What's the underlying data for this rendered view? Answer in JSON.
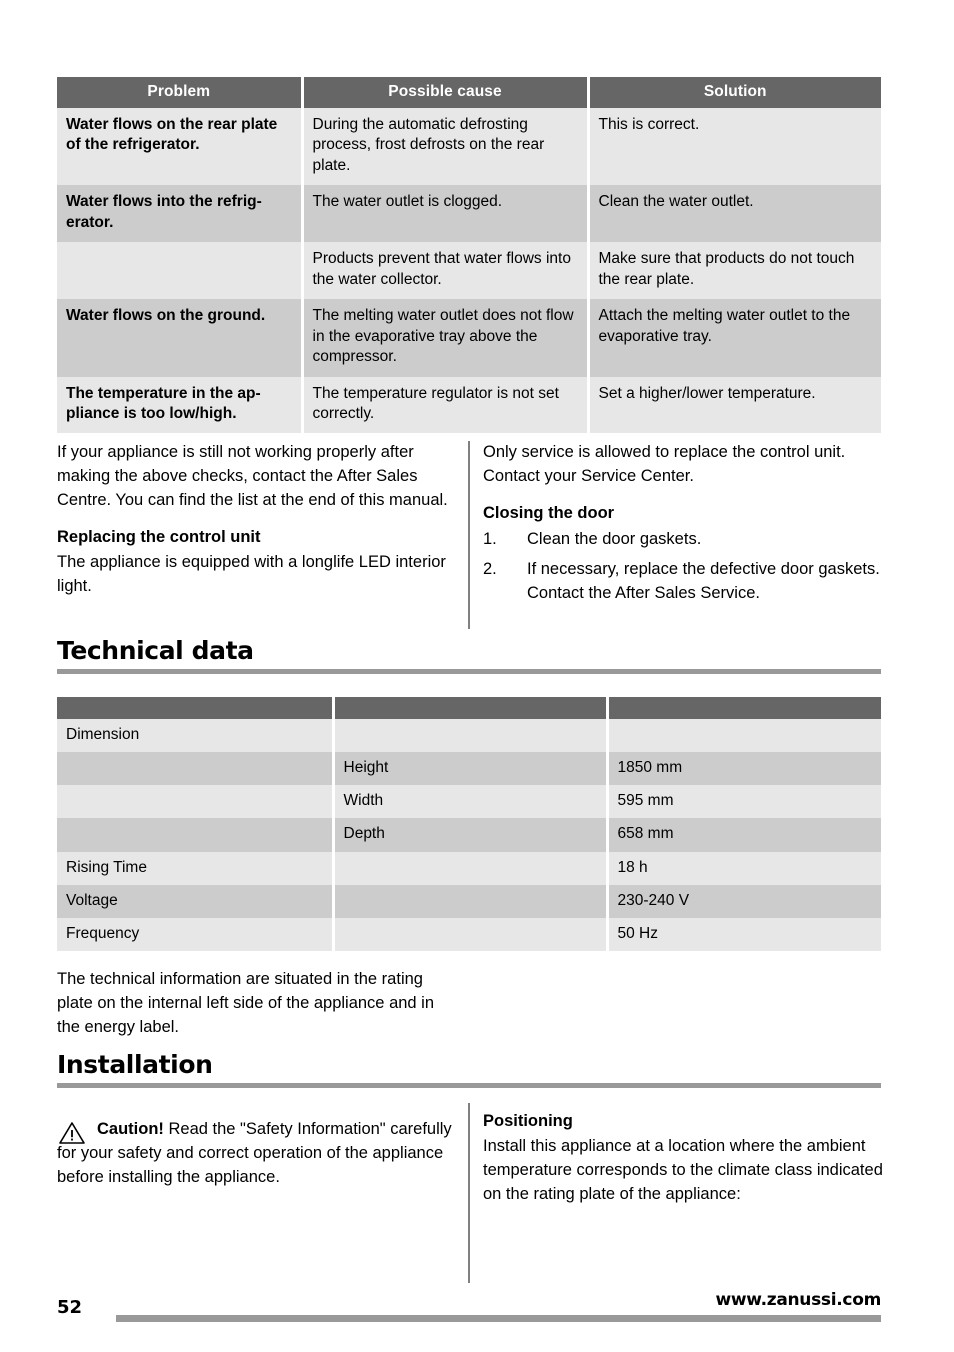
{
  "troubleshooting_table": {
    "headers": [
      "Problem",
      "Possible cause",
      "Solution"
    ],
    "rows": [
      {
        "problem": "Water flows on the rear plate of the refrigerator.",
        "cause": "During the automatic defrosting process, frost defrosts on the rear plate.",
        "solution": "This is correct."
      },
      {
        "problem": "Water flows into the refrig-erator.",
        "cause": "The water outlet is clogged.",
        "solution": "Clean the water outlet."
      },
      {
        "problem": "",
        "cause": "Products prevent that water flows into the water collector.",
        "solution": "Make sure that products do not touch the rear plate."
      },
      {
        "problem": "Water flows on the ground.",
        "cause": "The melting water outlet does not flow in the evaporative tray above the compressor.",
        "solution": "Attach the melting water outlet to the evaporative tray."
      },
      {
        "problem": "The temperature in the ap-pliance is too low/high.",
        "cause": "The temperature regulator is not set correctly.",
        "solution": "Set a higher/lower temperature."
      }
    ]
  },
  "service_columns": {
    "left": {
      "intro": "If your appliance is still not working properly after making the above checks, contact the After Sales Centre. You can find the list at the end of this manual.",
      "heading": "Replacing the control unit",
      "body": "The appliance is equipped with a longlife LED interior light."
    },
    "right": {
      "intro": "Only service is allowed to replace the control unit. Contact your Service Center.",
      "heading": "Closing the door",
      "steps": [
        {
          "num": "1.",
          "text": "Clean the door gaskets."
        },
        {
          "num": "2.",
          "text": "If necessary, replace the defective door gaskets. Contact the After Sales Service."
        }
      ]
    }
  },
  "technical_data": {
    "heading": "Technical data",
    "headers": [
      "",
      "",
      ""
    ],
    "rows": [
      {
        "label": "Dimension",
        "sub": "",
        "value": ""
      },
      {
        "label": "",
        "sub": "Height",
        "value": "1850 mm"
      },
      {
        "label": "",
        "sub": "Width",
        "value": "595 mm"
      },
      {
        "label": "",
        "sub": "Depth",
        "value": "658 mm"
      },
      {
        "label": "Rising Time",
        "sub": "",
        "value": "18 h"
      },
      {
        "label": "Voltage",
        "sub": "",
        "value": "230-240 V"
      },
      {
        "label": "Frequency",
        "sub": "",
        "value": "50 Hz"
      }
    ],
    "note": "The technical information are situated in the rating plate on the internal left side of the appliance and in the energy label."
  },
  "installation": {
    "heading": "Installation",
    "caution": {
      "icon": "warning-triangle-icon",
      "label": "Caution!",
      "text": " Read the \"Safety Information\" carefully for your safety and correct operation of the appliance before installing the appliance."
    },
    "positioning": {
      "heading": "Positioning",
      "body": "Install this appliance at a location where the ambient temperature corresponds to the climate class indicated on the rating plate of the appliance:"
    }
  },
  "footer": {
    "page_number": "52",
    "url": "www.zanussi.com"
  },
  "colors": {
    "header_gray": "#666666",
    "row_light": "#e7e7e7",
    "row_dark": "#cccccc",
    "rule_gray": "#999999",
    "divider_gray": "#808080"
  }
}
